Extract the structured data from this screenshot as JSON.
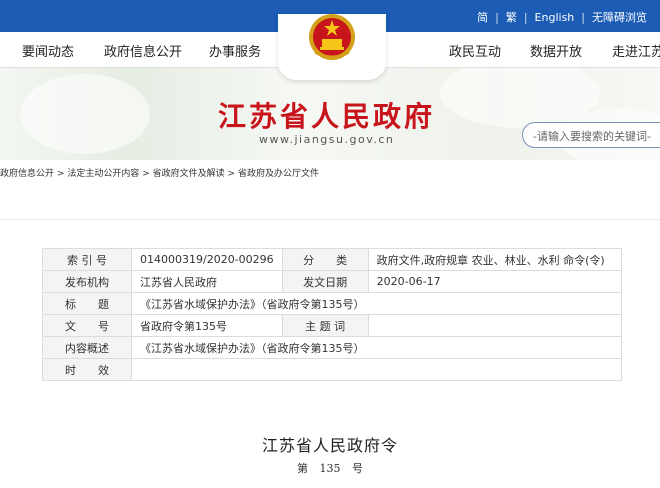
{
  "topbar": {
    "links": [
      "简",
      "繁",
      "English",
      "无障碍浏览"
    ],
    "separator": "|"
  },
  "nav": {
    "items": [
      "要闻动态",
      "政府信息公开",
      "办事服务",
      "政民互动",
      "数据开放",
      "走进江苏"
    ]
  },
  "banner": {
    "site_title": "江苏省人民政府",
    "site_url": "www.jiangsu.gov.cn",
    "search_placeholder": "-请输入要搜索的关键词-"
  },
  "breadcrumb": {
    "items": [
      "政府信息公开",
      "法定主动公开内容",
      "省政府文件及解读",
      "省政府及办公厅文件"
    ],
    "separator": ">"
  },
  "meta": {
    "index_label": "索 引 号",
    "index_value": "014000319/2020-00296",
    "category_label": "分　　类",
    "category_value": "政府文件,政府规章 农业、林业、水利 命令(令)",
    "issuer_label": "发布机构",
    "issuer_value": "江苏省人民政府",
    "date_label": "发文日期",
    "date_value": "2020-06-17",
    "title_label": "标　　题",
    "title_value": "《江苏省水域保护办法》（省政府令第135号）",
    "docno_label": "文　　号",
    "docno_value": "省政府令第135号",
    "subject_label": "主 题 词",
    "subject_value": "",
    "summary_label": "内容概述",
    "summary_value": "《江苏省水域保护办法》（省政府令第135号）",
    "validity_label": "时　　效",
    "validity_value": ""
  },
  "document": {
    "title": "江苏省人民政府令",
    "number": "第 135 号"
  },
  "colors": {
    "topbar": "#1c5cb5",
    "title_red": "#c8141b"
  }
}
